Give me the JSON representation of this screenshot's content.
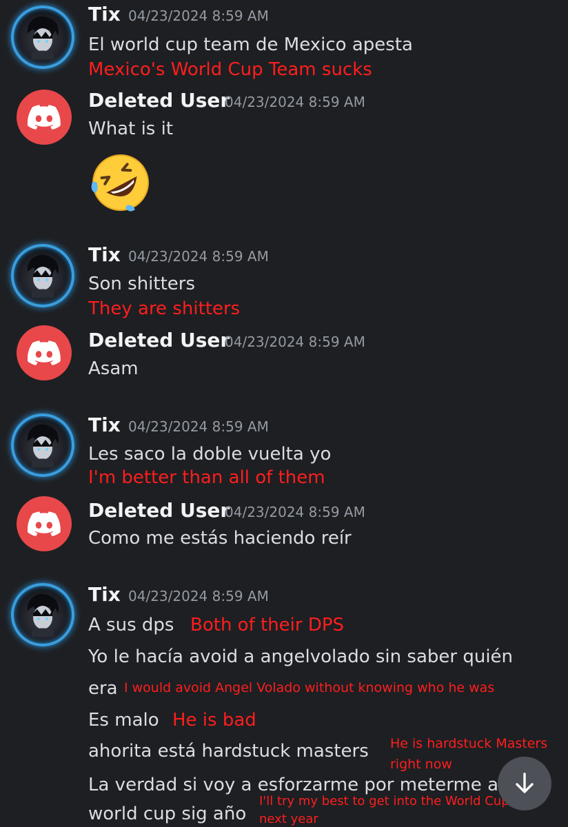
{
  "messages": [
    {
      "author": "Tix",
      "timestamp": "04/23/2024 8:59 AM",
      "lines": [
        "El world cup team de Mexico apesta"
      ],
      "translation": "Mexico's World Cup Team sucks"
    },
    {
      "author": "Deleted User",
      "timestamp": "04/23/2024 8:59 AM",
      "lines": [
        "What is it"
      ],
      "emoji": "rolling-on-floor-laughing"
    },
    {
      "author": "Tix",
      "timestamp": "04/23/2024 8:59 AM",
      "lines": [
        "Son shitters"
      ],
      "translation": "They are shitters"
    },
    {
      "author": "Deleted User",
      "timestamp": "04/23/2024 8:59 AM",
      "lines": [
        "Asam"
      ]
    },
    {
      "author": "Tix",
      "timestamp": "04/23/2024 8:59 AM",
      "lines": [
        "Les saco la doble vuelta yo"
      ],
      "translation": "I'm better than all of them"
    },
    {
      "author": "Deleted User",
      "timestamp": "04/23/2024 8:59 AM",
      "lines": [
        "Como me estás haciendo reír"
      ]
    },
    {
      "author": "Tix",
      "timestamp": "04/23/2024 8:59 AM",
      "lines": [
        "A sus dps",
        "Yo le hacía avoid a angelvolado sin saber quién",
        "era",
        "Es malo",
        "ahorita está hardstuck masters",
        "La verdad si voy a esforzarme por meterme a",
        "world cup sig año"
      ],
      "translations": [
        "Both of their DPS",
        "I would avoid Angel Volado without knowing who he was",
        "He is bad",
        "He is hardstuck Masters",
        "right now",
        "I'll try my best to get into the World Cup",
        "next year"
      ]
    }
  ],
  "colors": {
    "background": "#1e1f22",
    "translation": "#ff1e1e",
    "deleted_avatar": "#e8484a",
    "timestamp": "#949ba4"
  },
  "icons": {
    "deleted_avatar": "discord-logo-icon",
    "scroll": "arrow-down-icon"
  }
}
